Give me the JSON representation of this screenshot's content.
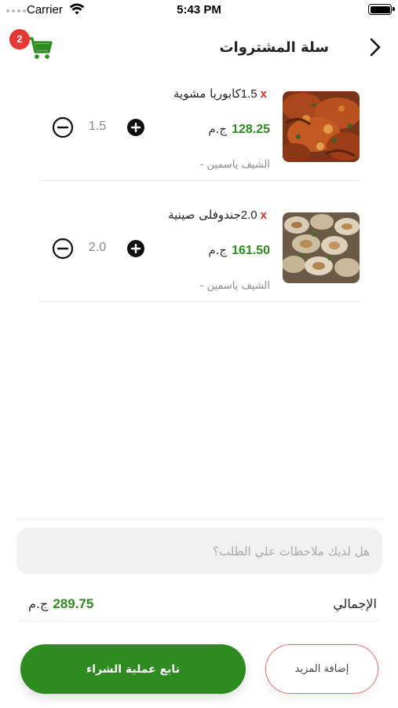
{
  "status_bar": {
    "carrier": "Carrier",
    "time": "5:43 PM"
  },
  "nav": {
    "title": "سلة المشتروات",
    "cart_badge": "2",
    "cart_icon": "shopping-cart-icon",
    "back_icon": "chevron-right-icon",
    "accent_color": "#2e8b1f",
    "badge_color": "#e53935"
  },
  "cart": {
    "items": [
      {
        "quantity_label": "1.5",
        "multiplier": "x",
        "name": "كابوريا مشوية",
        "price": "128.25",
        "currency": "ج.م",
        "chef": "الشيف ياسمين -",
        "stepper_value": "1.5"
      },
      {
        "quantity_label": "2.0",
        "multiplier": "x",
        "name": "جندوفلى صينية",
        "price": "161.50",
        "currency": "ج.م",
        "chef": "الشيف ياسمين -",
        "stepper_value": "2.0"
      }
    ]
  },
  "notes": {
    "placeholder": "هل لديك ملاحظات علي الطلب؟",
    "value": ""
  },
  "total": {
    "label": "الإجمالي",
    "amount": "289.75",
    "currency": "ج.م"
  },
  "actions": {
    "checkout_label": "تابع عملية الشراء",
    "add_more_label": "إضافة المزيد"
  }
}
